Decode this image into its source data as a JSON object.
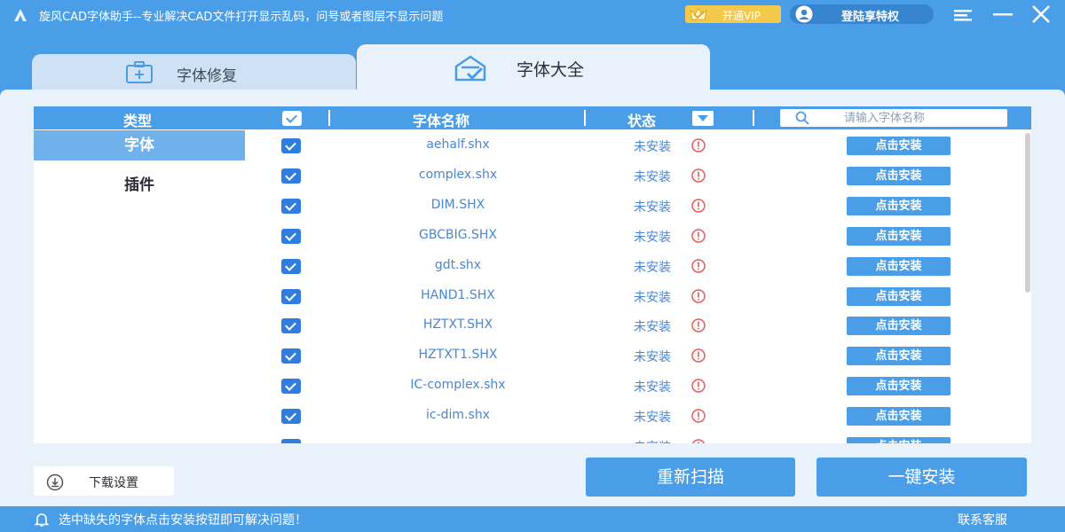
{
  "titlebar": {
    "title": "旋风CAD字体助手--专业解决CAD文件打开显示乱码，问号或者图层不显示问题",
    "vip_label": "开通VIP",
    "login_label": "登陆享特权",
    "accent": "#4a9ee8",
    "vip_color": "#f2c94c"
  },
  "tabs": [
    {
      "label": "字体修复",
      "icon": "medkit-icon"
    },
    {
      "label": "字体大全",
      "icon": "font-library-icon"
    }
  ],
  "table": {
    "col_type": "类型",
    "col_name": "字体名称",
    "col_status": "状态",
    "search_placeholder": "请输入字体名称",
    "categories": [
      "字体",
      "插件"
    ],
    "rows": [
      {
        "name": "aehalf.shx",
        "status": "未安装",
        "action": "点击安装"
      },
      {
        "name": "complex.shx",
        "status": "未安装",
        "action": "点击安装"
      },
      {
        "name": "DIM.SHX",
        "status": "未安装",
        "action": "点击安装"
      },
      {
        "name": "GBCBIG.SHX",
        "status": "未安装",
        "action": "点击安装"
      },
      {
        "name": "gdt.shx",
        "status": "未安装",
        "action": "点击安装"
      },
      {
        "name": "HAND1.SHX",
        "status": "未安装",
        "action": "点击安装"
      },
      {
        "name": "HZTXT.SHX",
        "status": "未安装",
        "action": "点击安装"
      },
      {
        "name": "HZTXT1.SHX",
        "status": "未安装",
        "action": "点击安装"
      },
      {
        "name": "IC-complex.shx",
        "status": "未安装",
        "action": "点击安装"
      },
      {
        "name": "ic-dim.shx",
        "status": "未安装",
        "action": "点击安装"
      },
      {
        "name": "",
        "status": "未安装",
        "action": "点击安装"
      }
    ],
    "status_color": "#4a86d4",
    "warn_color": "#e65c5c"
  },
  "bottom": {
    "download_settings": "下载设置",
    "rescan": "重新扫描",
    "install_all": "一键安装"
  },
  "statusbar": {
    "message": "选中缺失的字体点击安装按钮即可解决问题！",
    "contact": "联系客服"
  }
}
